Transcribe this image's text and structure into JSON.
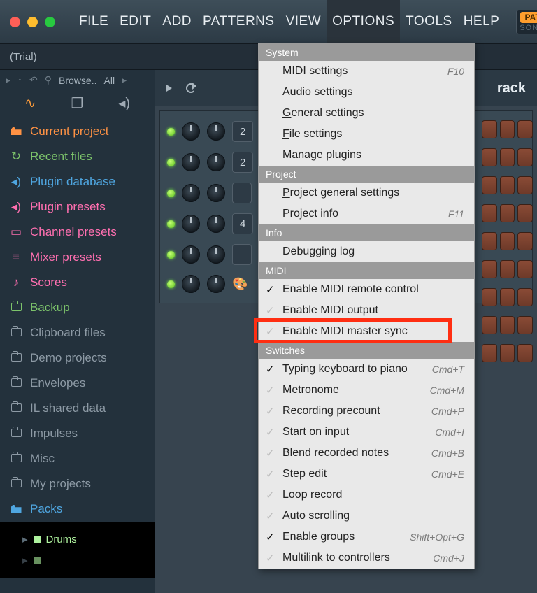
{
  "menubar": {
    "items": [
      "FILE",
      "EDIT",
      "ADD",
      "PATTERNS",
      "VIEW",
      "OPTIONS",
      "TOOLS",
      "HELP"
    ],
    "selected_index": 5,
    "mode_pill": {
      "top": "PAT",
      "bottom": "SONG"
    }
  },
  "subtitle": "(Trial)",
  "browser": {
    "header_label": "Browse..",
    "header_scope": "All",
    "tree": [
      {
        "icon": "folder-solid",
        "color": "c-orange",
        "label": "Current project"
      },
      {
        "icon": "reload",
        "color": "c-green",
        "label": "Recent files"
      },
      {
        "icon": "speaker",
        "color": "c-blue",
        "label": "Plugin database"
      },
      {
        "icon": "speaker",
        "color": "c-pink",
        "label": "Plugin presets"
      },
      {
        "icon": "panel",
        "color": "c-pink",
        "label": "Channel presets"
      },
      {
        "icon": "sliders",
        "color": "c-pink",
        "label": "Mixer presets"
      },
      {
        "icon": "note",
        "color": "c-pink",
        "label": "Scores"
      },
      {
        "icon": "folder-open",
        "color": "c-green",
        "label": "Backup"
      },
      {
        "icon": "folder-open",
        "color": "c-folder",
        "label": "Clipboard files"
      },
      {
        "icon": "folder-open",
        "color": "c-folder",
        "label": "Demo projects"
      },
      {
        "icon": "folder-open",
        "color": "c-folder",
        "label": "Envelopes"
      },
      {
        "icon": "folder-open",
        "color": "c-folder",
        "label": "IL shared data"
      },
      {
        "icon": "folder-open",
        "color": "c-folder",
        "label": "Impulses"
      },
      {
        "icon": "folder-open",
        "color": "c-folder",
        "label": "Misc"
      },
      {
        "icon": "folder-open",
        "color": "c-folder",
        "label": "My projects"
      },
      {
        "icon": "packs",
        "color": "c-blue",
        "label": "Packs"
      }
    ],
    "packs_children": [
      "Drums"
    ]
  },
  "rack": {
    "title": "rack",
    "channels": [
      "2",
      "2",
      "",
      "4",
      "",
      ""
    ]
  },
  "options_menu": {
    "sections": [
      {
        "header": "System",
        "items": [
          {
            "label": "MIDI settings",
            "u": "M",
            "shortcut": "F10"
          },
          {
            "label": "Audio settings",
            "u": "A"
          },
          {
            "label": "General settings",
            "u": "G"
          },
          {
            "label": "File settings",
            "u": "F"
          },
          {
            "label": "Manage plugins"
          }
        ]
      },
      {
        "header": "Project",
        "items": [
          {
            "label": "Project general settings",
            "u": "P"
          },
          {
            "label": "Project info",
            "shortcut": "F11"
          }
        ]
      },
      {
        "header": "Info",
        "items": [
          {
            "label": "Debugging log"
          }
        ]
      },
      {
        "header": "MIDI",
        "items": [
          {
            "label": "Enable MIDI remote control",
            "check": "on",
            "highlighted": true
          },
          {
            "label": "Enable MIDI output",
            "check": "off"
          },
          {
            "label": "Enable MIDI master sync",
            "check": "off"
          }
        ]
      },
      {
        "header": "Switches",
        "items": [
          {
            "label": "Typing keyboard to piano",
            "check": "on",
            "shortcut": "Cmd+T"
          },
          {
            "label": "Metronome",
            "check": "off",
            "shortcut": "Cmd+M"
          },
          {
            "label": "Recording precount",
            "check": "off",
            "shortcut": "Cmd+P"
          },
          {
            "label": "Start on input",
            "check": "off",
            "shortcut": "Cmd+I"
          },
          {
            "label": "Blend recorded notes",
            "check": "off",
            "shortcut": "Cmd+B"
          },
          {
            "label": "Step edit",
            "check": "off",
            "shortcut": "Cmd+E"
          },
          {
            "label": "Loop record",
            "check": "off"
          },
          {
            "label": "Auto scrolling",
            "check": "off"
          },
          {
            "label": "Enable groups",
            "check": "on",
            "shortcut": "Shift+Opt+G"
          },
          {
            "label": "Multilink to controllers",
            "check": "off",
            "shortcut": "Cmd+J"
          }
        ]
      }
    ]
  }
}
